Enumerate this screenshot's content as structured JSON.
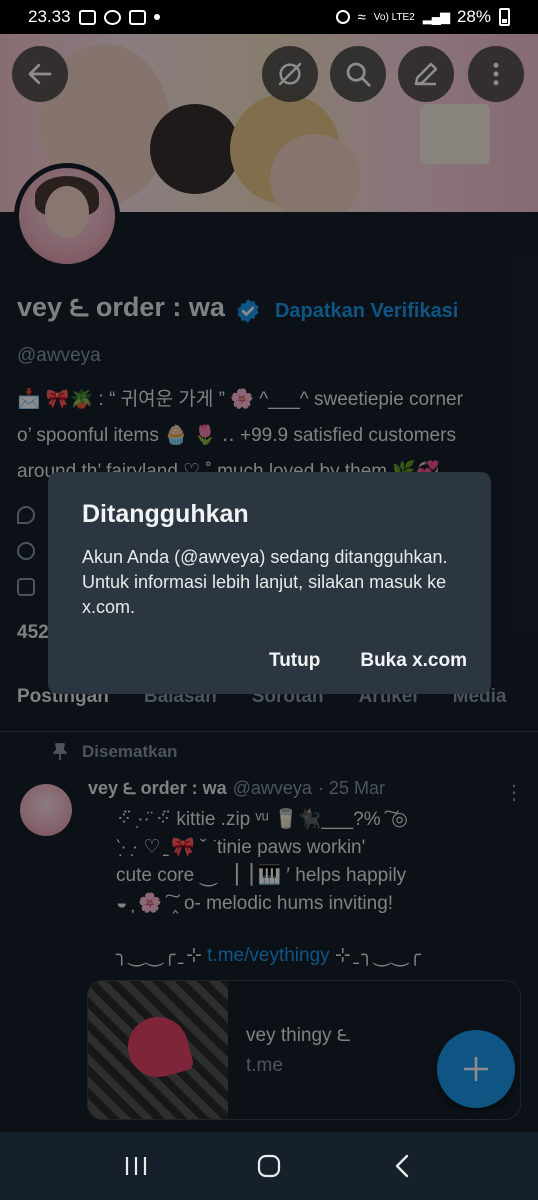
{
  "status_bar": {
    "time": "23.33",
    "network": "Vo) LTE2",
    "battery": "28%"
  },
  "profile": {
    "display_name": "vey ౬ order : wa",
    "get_verified": "Dapatkan Verifikasi",
    "handle": "@awveya",
    "bio_lines": [
      "📩 🎀🪴 : “ 귀여운 가게 ” 🌸 ^___^ sweetiepie corner",
      "o’ spoonful items 🧁 🌷 ‥ +99.9 satisfied customers",
      "around th’ fairyland ♡ ˚ much loved by them 🌿💞"
    ],
    "follow_count": "452"
  },
  "tabs": [
    "Postingan",
    "Balasan",
    "Sorotan",
    "Artikel",
    "Media"
  ],
  "feed": {
    "pinned_label": "Disematkan",
    "post": {
      "name": "vey ౬ order : wa",
      "handle": "@awveya",
      "date": "· 25 Mar",
      "text_lines": [
        "⁘̈ ·̣·̈ ⁘̈  kittie  .zip  ᵛᵘ  🥛🐈‍⬛___?%  ͠ ◎",
        "‵·̣ ·̣ ♡   ̠ 🎀  ˇ ͘    tinie   paws   workin'",
        "cute   core   ⏝ ▕▕ 🎹 ′   helps   happily",
        "◒ ̦  🌸 ͠ ‸  o-  melodic   hums   inviting!"
      ],
      "link_prefix": "╮⏝⏝╭ ̠ ⊹ ",
      "link": "t.me/veythingy",
      "link_suffix": " ⊹ ̠ ╮⏝⏝╭",
      "card_title": "vey thingy ౬",
      "card_domain": "t.me"
    }
  },
  "dialog": {
    "title": "Ditangguhkan",
    "body": "Akun Anda (@awveya) sedang ditangguhkan. Untuk informasi lebih lanjut, silakan masuk ke x.com.",
    "close_label": "Tutup",
    "open_label": "Buka x.com"
  },
  "colors": {
    "accent": "#1d9bf0",
    "background": "#15202b",
    "dialog": "#2c3640",
    "muted": "#8b98a5"
  }
}
